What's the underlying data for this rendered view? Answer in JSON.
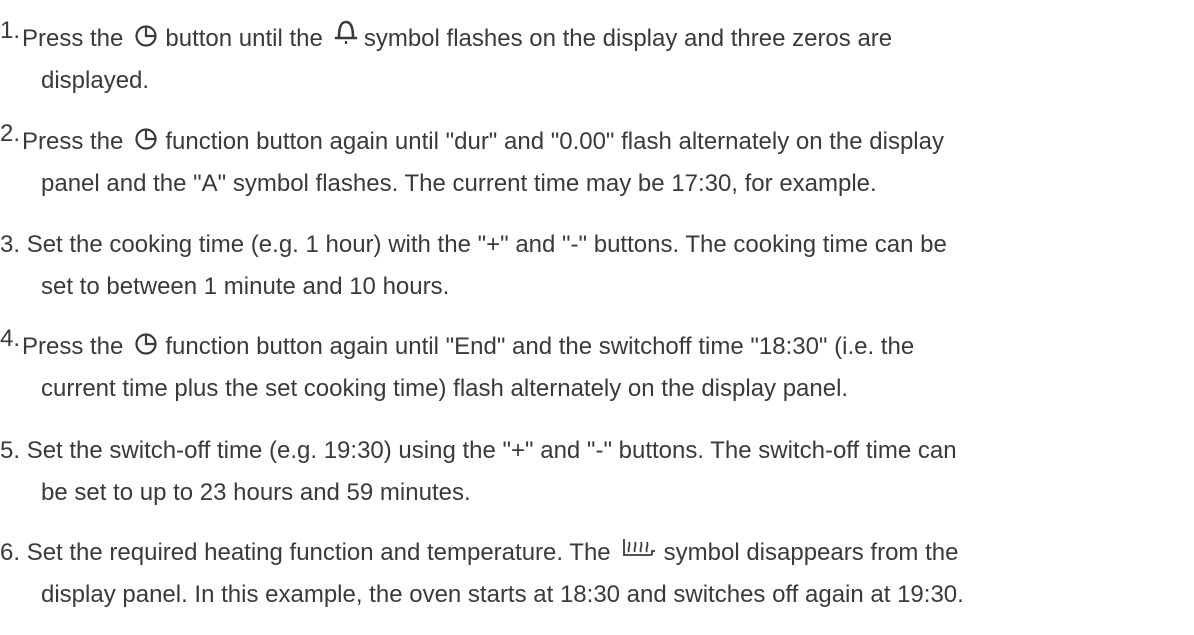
{
  "steps": [
    {
      "number": "1.",
      "lines": [
        {
          "parts": [
            "Press the",
            "button until the",
            "symbol flashes on the display and three zeros are"
          ]
        },
        {
          "text": "displayed."
        }
      ],
      "icons": [
        "clock-icon",
        "bell-icon"
      ]
    },
    {
      "number": "2.",
      "lines": [
        {
          "parts": [
            "Press the",
            "function button again until \"dur\" and \"0.00\" flash alternately on the display"
          ]
        },
        {
          "text": "panel and the \"A\" symbol flashes. The current time may be 17:30, for example."
        }
      ],
      "icons": [
        "clock-icon"
      ]
    },
    {
      "number": "3.",
      "lines": [
        {
          "text": "Set the cooking time (e.g. 1 hour) with the \"+\" and \"-\" buttons. The cooking time can be"
        },
        {
          "text": "set to between 1 minute and 10 hours."
        }
      ]
    },
    {
      "number": "4.",
      "lines": [
        {
          "parts": [
            "Press the",
            "function button again until \"End\" and the switchoff time \"18:30\" (i.e. the"
          ]
        },
        {
          "text": "current time plus the set cooking time) flash alternately on the display panel."
        }
      ],
      "icons": [
        "clock-icon"
      ]
    },
    {
      "number": "5.",
      "lines": [
        {
          "text": "Set the switch-off time (e.g. 19:30) using the \"+\" and \"-\" buttons. The switch-off time can"
        },
        {
          "text": "be set to up to 23 hours and 59 minutes."
        }
      ]
    },
    {
      "number": "6.",
      "lines": [
        {
          "parts": [
            "Set the required heating function and temperature. The",
            "symbol disappears from the"
          ]
        },
        {
          "text": "display panel. In this example, the oven starts at 18:30 and switches off again at 19:30."
        }
      ],
      "icons": [
        "heat-icon"
      ]
    }
  ],
  "colors": {
    "text": "#3a3a3a"
  }
}
